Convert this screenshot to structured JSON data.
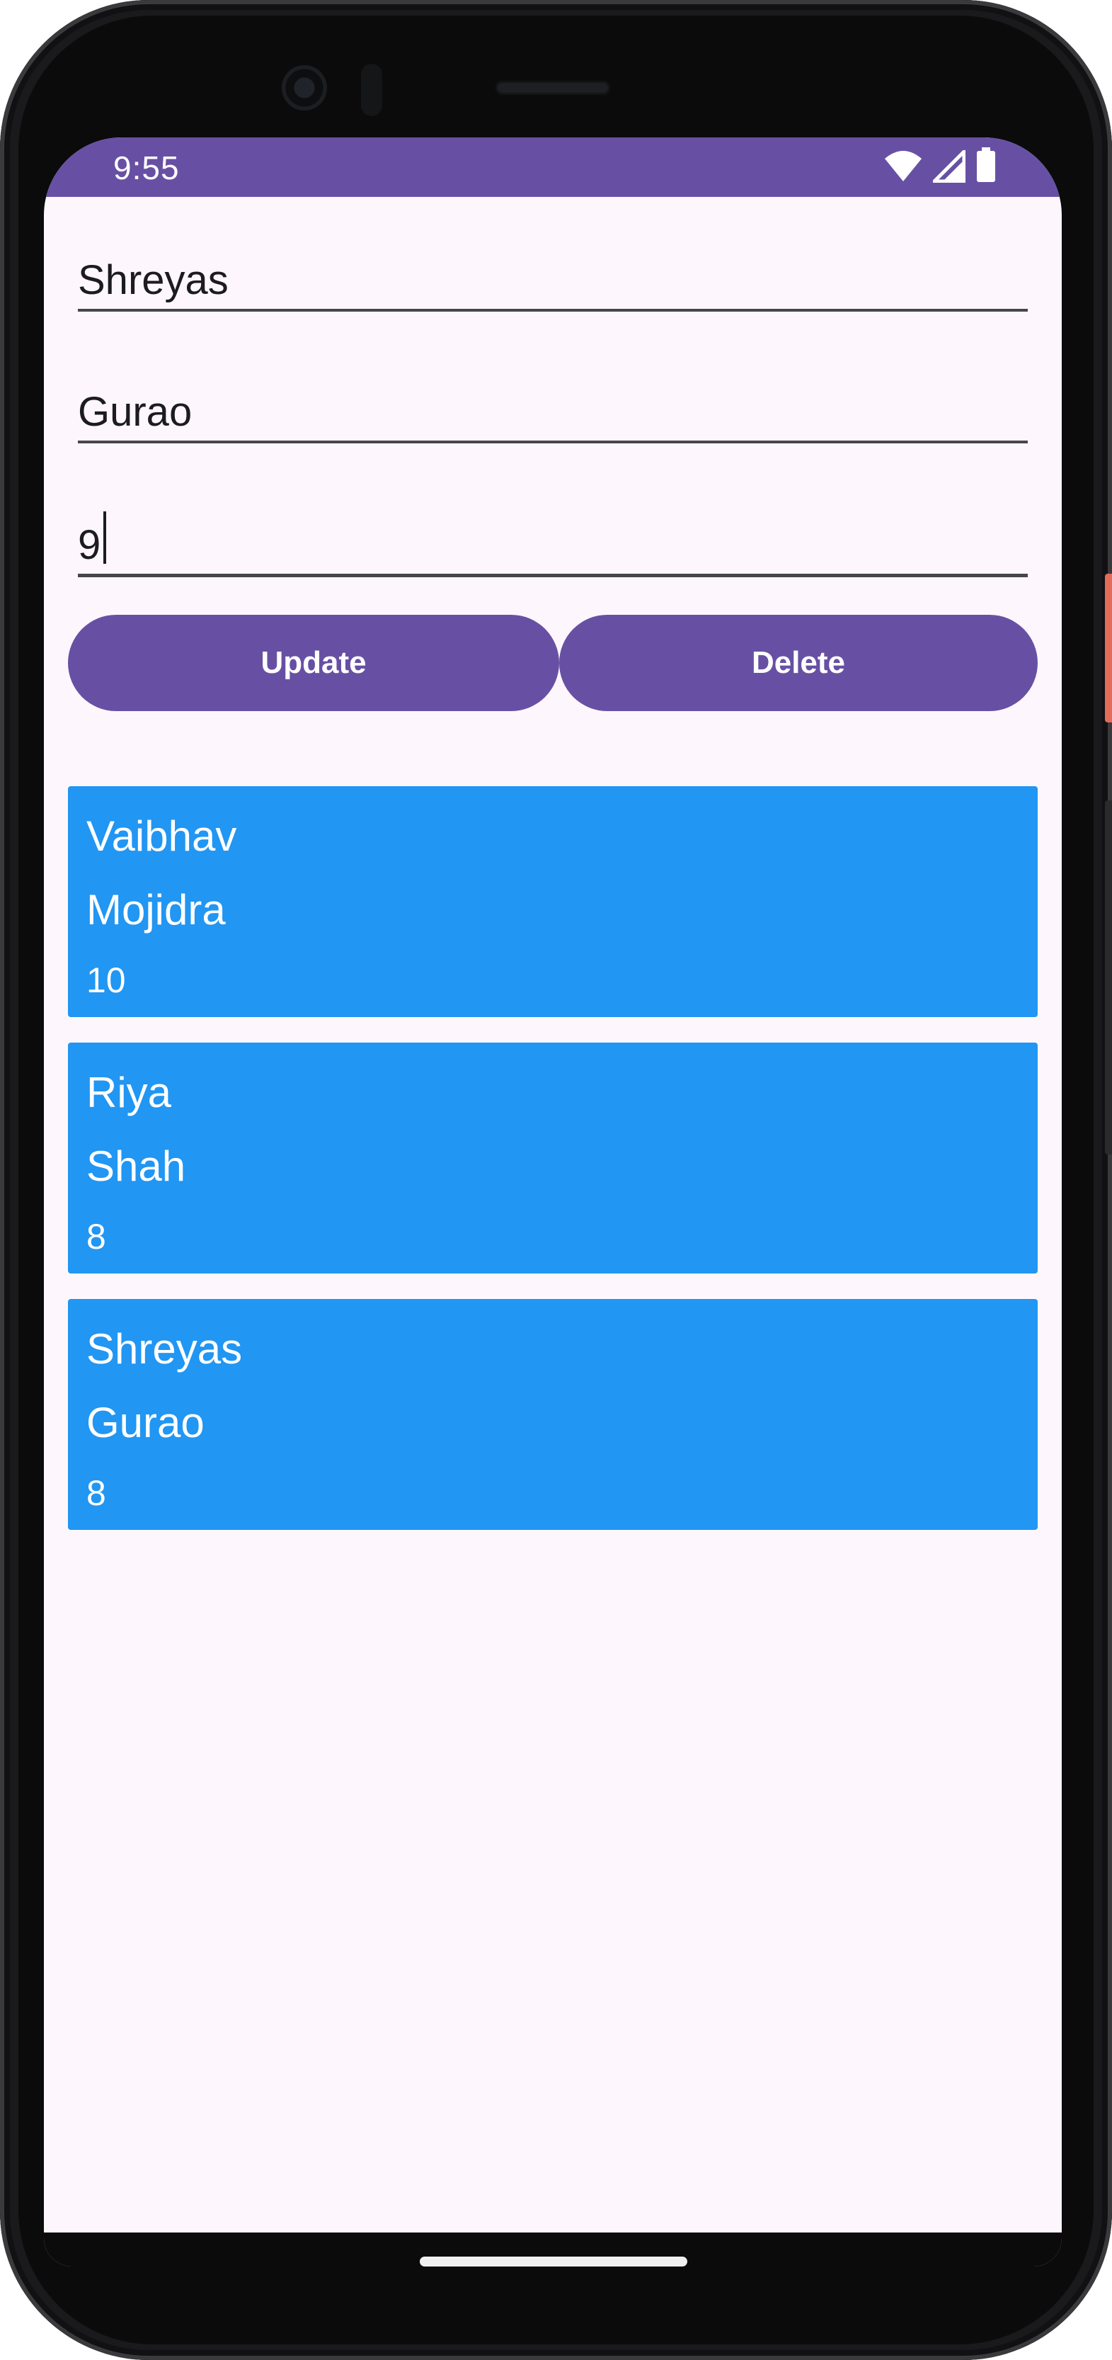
{
  "status_bar": {
    "time": "9:55",
    "icons": [
      "wifi-icon",
      "cell-signal-icon",
      "battery-icon"
    ],
    "color": "#6750a4"
  },
  "form": {
    "first_name_value": "Shreyas",
    "last_name_value": "Gurao",
    "number_value": "9"
  },
  "buttons": {
    "update_label": "Update",
    "delete_label": "Delete",
    "color": "#6750a4"
  },
  "list": {
    "card_color": "#2196f3",
    "items": [
      {
        "first": "Vaibhav",
        "last": "Mojidra",
        "number": "10"
      },
      {
        "first": "Riya",
        "last": "Shah",
        "number": "8"
      },
      {
        "first": "Shreyas",
        "last": "Gurao",
        "number": "8"
      }
    ]
  }
}
